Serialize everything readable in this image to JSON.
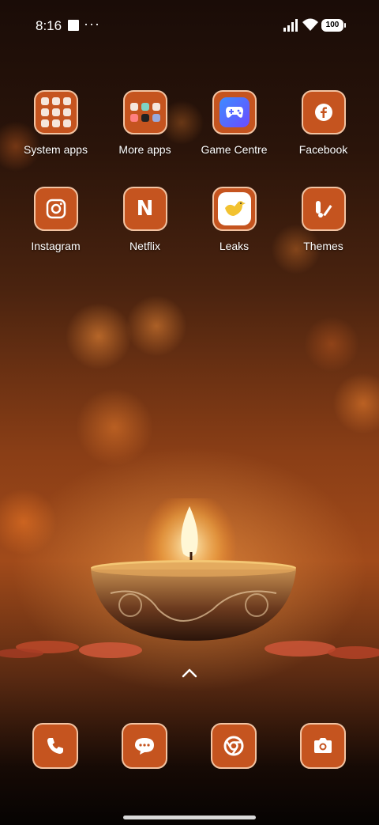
{
  "status_bar": {
    "time": "8:16",
    "more": "···",
    "battery": "100"
  },
  "apps": [
    {
      "label": "System apps",
      "icon": "folder-icon"
    },
    {
      "label": "More apps",
      "icon": "folder-icon"
    },
    {
      "label": "Game Centre",
      "icon": "gamepad-icon"
    },
    {
      "label": "Facebook",
      "icon": "facebook-icon"
    },
    {
      "label": "Instagram",
      "icon": "camera-icon"
    },
    {
      "label": "Netflix",
      "icon": "netflix-icon",
      "glyph": "N"
    },
    {
      "label": "Leaks",
      "icon": "bird-icon"
    },
    {
      "label": "Themes",
      "icon": "themes-icon"
    }
  ],
  "dock": [
    {
      "icon": "phone-icon"
    },
    {
      "icon": "messages-icon"
    },
    {
      "icon": "chrome-icon"
    },
    {
      "icon": "camera-icon"
    }
  ],
  "colors": {
    "icon_bg": "#c5541f",
    "icon_border": "#f2c3a2"
  }
}
